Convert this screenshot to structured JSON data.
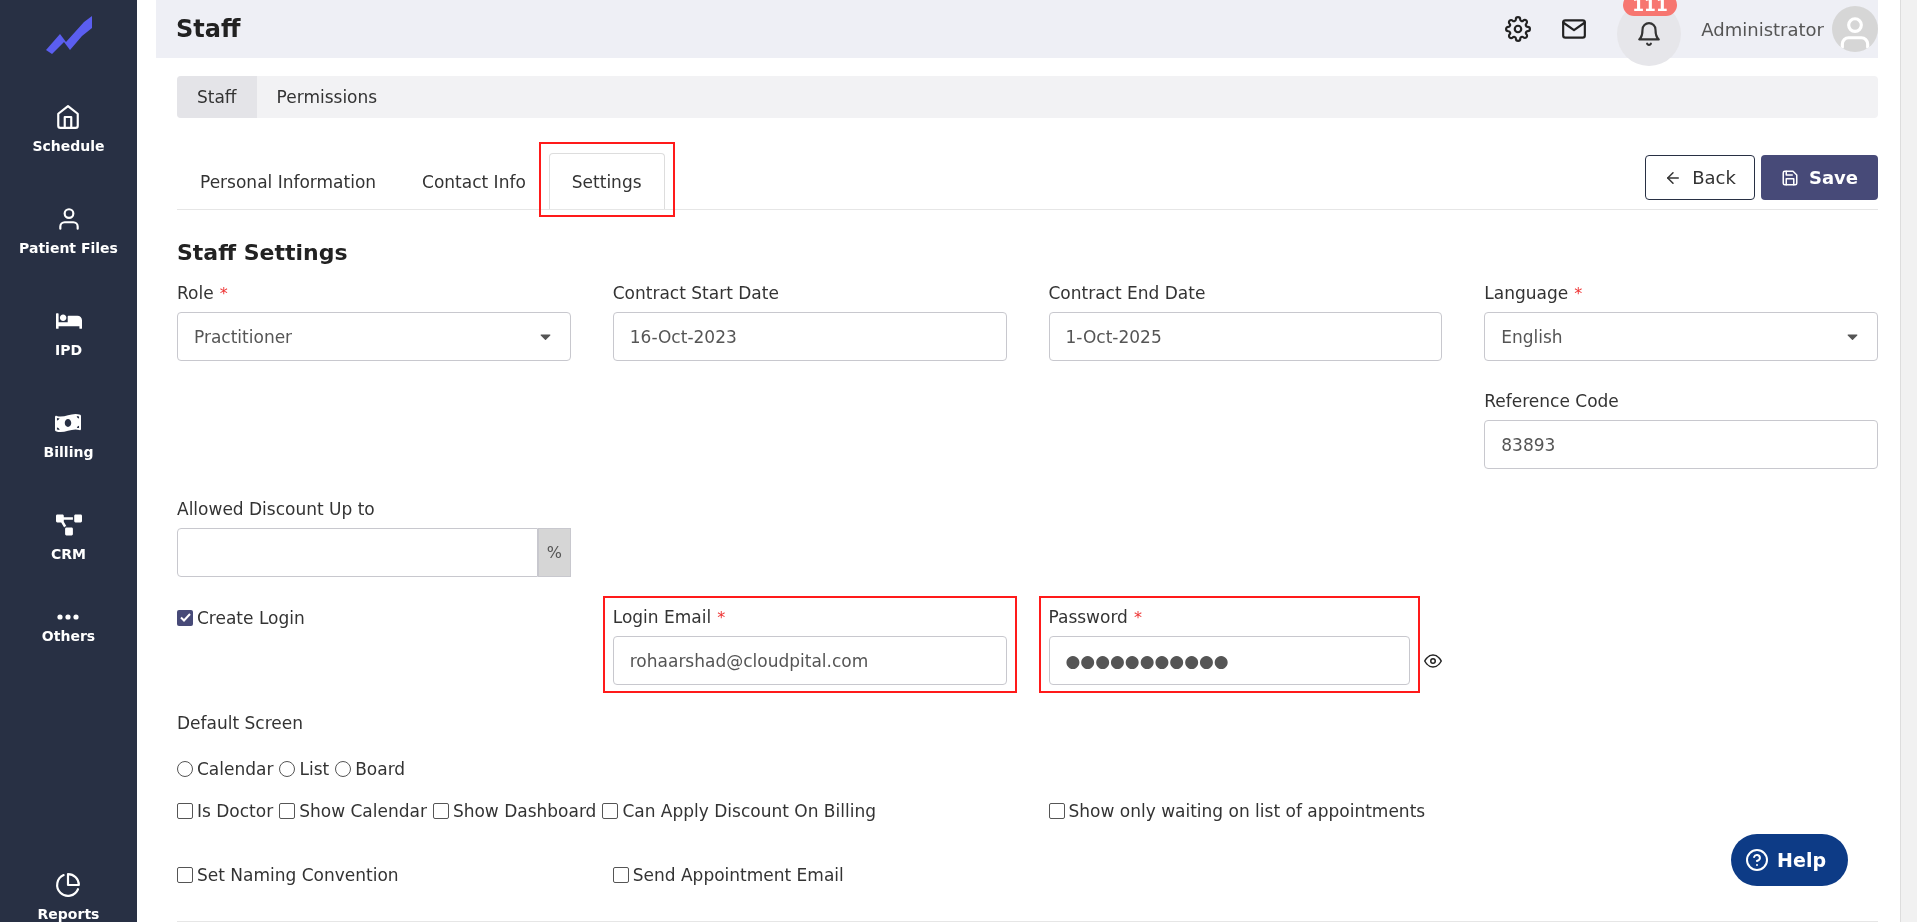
{
  "sidebar": {
    "items": [
      {
        "label": "Schedule"
      },
      {
        "label": "Patient Files"
      },
      {
        "label": "IPD"
      },
      {
        "label": "Billing"
      },
      {
        "label": "CRM"
      },
      {
        "label": "Others"
      }
    ],
    "bottom_item": {
      "label": "Reports"
    }
  },
  "header": {
    "title": "Staff",
    "notification_count": "111",
    "user": "Administrator"
  },
  "section_tabs": [
    {
      "label": "Staff",
      "selected": true
    },
    {
      "label": "Permissions",
      "selected": false
    }
  ],
  "form_tabs": [
    {
      "label": "Personal Information",
      "selected": false,
      "highlighted": false
    },
    {
      "label": "Contact Info",
      "selected": false,
      "highlighted": false
    },
    {
      "label": "Settings",
      "selected": true,
      "highlighted": true
    }
  ],
  "buttons": {
    "back": "Back",
    "save": "Save"
  },
  "section_title": "Staff Settings",
  "fields": {
    "role": {
      "label": "Role",
      "required_mark": "*",
      "value": "Practitioner"
    },
    "contract_start": {
      "label": "Contract Start Date",
      "value": "16-Oct-2023"
    },
    "contract_end": {
      "label": "Contract End Date",
      "value": "1-Oct-2025"
    },
    "language": {
      "label": "Language",
      "required_mark": "*",
      "value": "English"
    },
    "reference_code": {
      "label": "Reference Code",
      "value": "83893"
    },
    "allowed_discount": {
      "label": "Allowed Discount Up to",
      "suffix": "%"
    },
    "create_login": {
      "label": "Create Login",
      "checked": true
    },
    "login_email": {
      "label": "Login Email",
      "required_mark": "*",
      "value": "rohaarshad@cloudpital.com",
      "highlighted": true
    },
    "password": {
      "label": "Password",
      "required_mark": "*",
      "value": "●●●●●●●●●●●",
      "highlighted": true
    }
  },
  "default_screen": {
    "label": "Default Screen",
    "options": [
      {
        "label": "Calendar",
        "selected": false
      },
      {
        "label": "List",
        "selected": false
      },
      {
        "label": "Board",
        "selected": false
      }
    ]
  },
  "options_row_1": [
    {
      "label": "Is Doctor",
      "checked": false
    },
    {
      "label": "Show Calendar",
      "checked": false
    },
    {
      "label": "Show Dashboard",
      "checked": false
    },
    {
      "label": "Can Apply Discount On Billing",
      "checked": false
    }
  ],
  "option_waiting": {
    "label": "Show only waiting on list of appointments",
    "checked": false
  },
  "options_row_2": [
    {
      "label": "Set Naming Convention",
      "checked": false
    },
    {
      "label": "Send Appointment Email",
      "checked": false
    }
  ],
  "help_button": "Help"
}
